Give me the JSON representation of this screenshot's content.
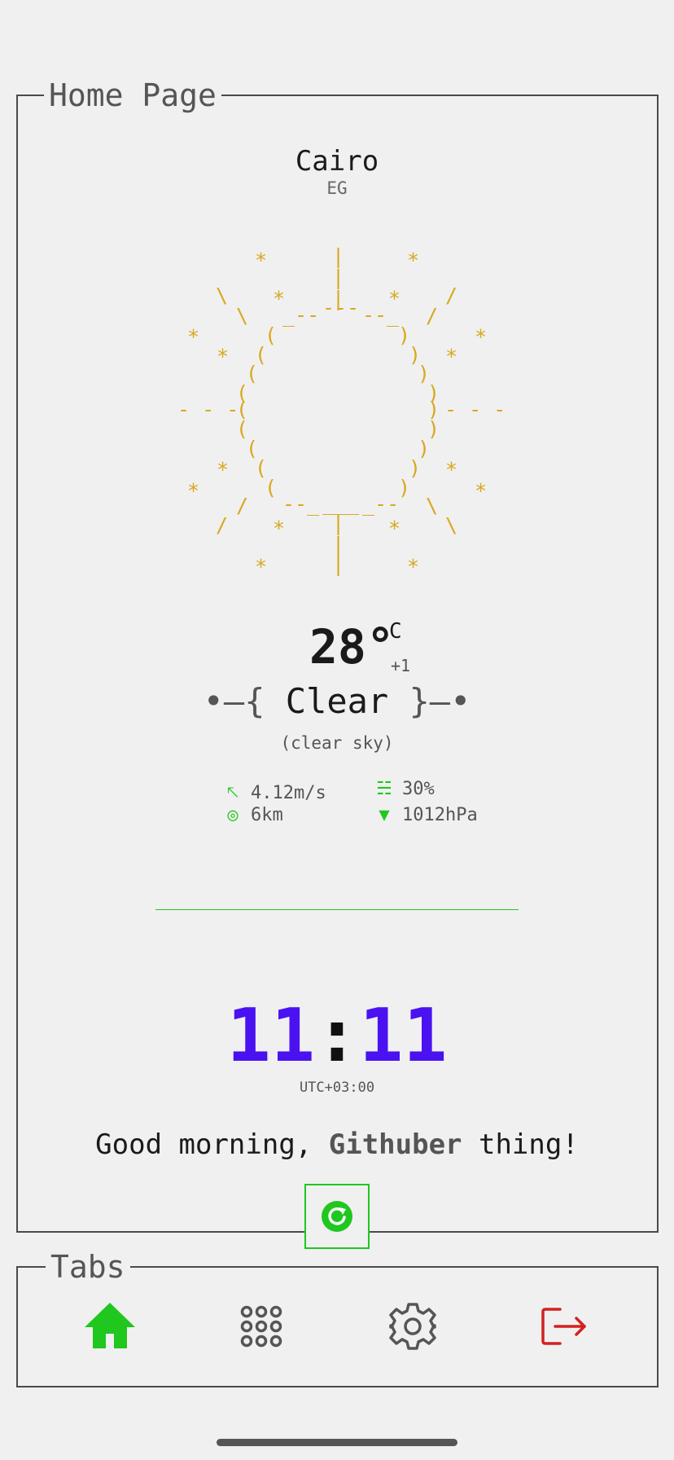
{
  "home": {
    "legend": "Home Page",
    "city": "Cairo",
    "country": "EG",
    "temperature": "28",
    "degree": "°",
    "unit": "C",
    "feels_like": "+1",
    "condition_left": "•–{",
    "condition": "Clear",
    "condition_right": "}–•",
    "description": "(clear sky)",
    "wind": "4.12m/s",
    "humidity": "30%",
    "visibility": "6km",
    "pressure": "1012hPa",
    "time_hours": "11",
    "time_sep": ":",
    "time_minutes": "11",
    "timezone": "UTC+03:00",
    "greeting_prefix": "Good morning, ",
    "greeting_name": "Githuber",
    "greeting_suffix": " thing!",
    "accent_color": "#1fc71f",
    "clock_color": "#4a12f0",
    "sun_color": "#d9a81f"
  },
  "tabs": {
    "legend": "Tabs",
    "items": [
      "home-icon",
      "apps-grid-icon",
      "gear-icon",
      "logout-icon"
    ],
    "logout_color": "#d42121"
  }
}
